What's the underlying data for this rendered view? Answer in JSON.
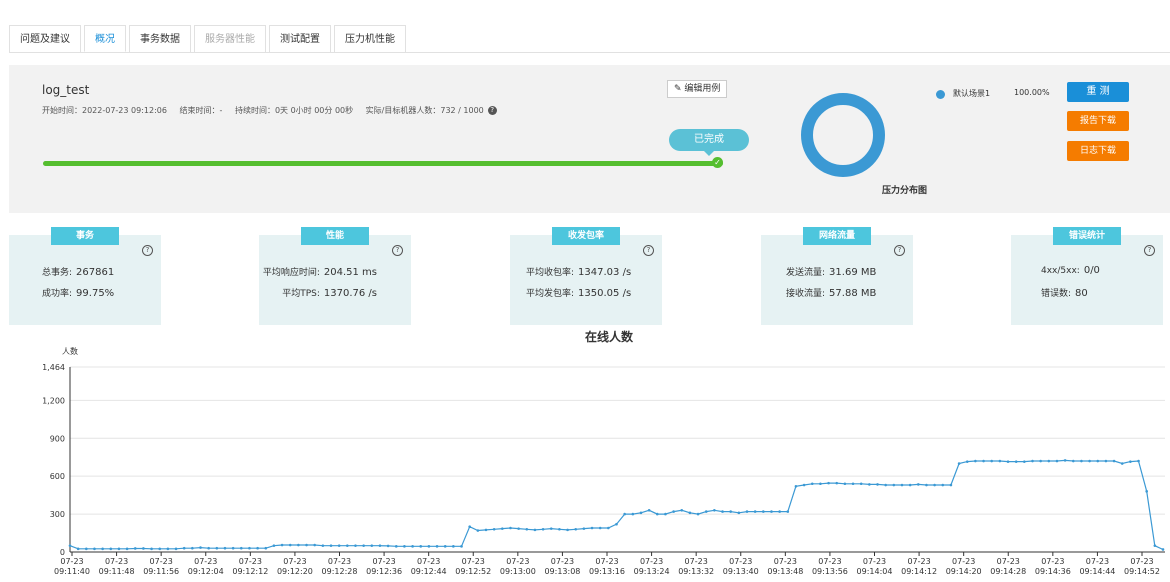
{
  "tabs": [
    {
      "label": "问题及建议",
      "state": "normal"
    },
    {
      "label": "概况",
      "state": "active"
    },
    {
      "label": "事务数据",
      "state": "normal"
    },
    {
      "label": "服务器性能",
      "state": "disabled"
    },
    {
      "label": "测试配置",
      "state": "normal"
    },
    {
      "label": "压力机性能",
      "state": "normal"
    }
  ],
  "summary": {
    "title": "log_test",
    "start": "开始时间：2022-07-23 09:12:06",
    "end": "结束时间：-",
    "duration": "持续时间：0天 0小时 00分 00秒",
    "machines": "实际/目标机器人数：732 / 1000",
    "help_icon": "question-circle-icon",
    "edit_label": "编辑用例",
    "edit_icon": "pencil-icon",
    "status": "已完成",
    "progress": 1.0,
    "donut_label": "压力分布图",
    "legend_name": "默认场景1",
    "legend_pct": "100.00%",
    "btn_retest": "重 测",
    "btn_report": "报告下载",
    "btn_log": "日志下载",
    "colors": {
      "accent": "#1a8fd8",
      "orange": "#f57c00",
      "green": "#55be2f",
      "teal": "#4dc6dd",
      "donut": "#3b99d4"
    }
  },
  "cards": [
    {
      "tab": "事务",
      "rows": [
        {
          "k": "总事务:",
          "v": "267861"
        },
        {
          "k": "成功率:",
          "v": "99.75%"
        }
      ]
    },
    {
      "tab": "性能",
      "rows": [
        {
          "k": "平均响应时间:",
          "v": "204.51 ms"
        },
        {
          "k": "平均TPS:",
          "v": "1370.76 /s"
        }
      ]
    },
    {
      "tab": "收发包率",
      "rows": [
        {
          "k": "平均收包率:",
          "v": "1347.03 /s"
        },
        {
          "k": "平均发包率:",
          "v": "1350.05 /s"
        }
      ]
    },
    {
      "tab": "网络流量",
      "rows": [
        {
          "k": "发送流量:",
          "v": "31.69 MB"
        },
        {
          "k": "接收流量:",
          "v": "57.88 MB"
        }
      ]
    },
    {
      "tab": "错误统计",
      "rows": [
        {
          "k": "4xx/5xx:",
          "v": "0/0"
        },
        {
          "k": "错误数:",
          "v": "80"
        }
      ]
    }
  ],
  "chart_data": {
    "type": "line",
    "title": "在线人数",
    "ylabel": "人数",
    "ylim": [
      0,
      1464
    ],
    "yticks": [
      0,
      300,
      600,
      900,
      1200,
      1464
    ],
    "ytick_labels": [
      "0",
      "300",
      "600",
      "900",
      "1,200",
      "1,464"
    ],
    "xtick_labels": [
      "07-23 09:11:40",
      "07-23 09:11:48",
      "07-23 09:11:56",
      "07-23 09:12:04",
      "07-23 09:12:12",
      "07-23 09:12:20",
      "07-23 09:12:28",
      "07-23 09:12:36",
      "07-23 09:12:44",
      "07-23 09:12:52",
      "07-23 09:13:00",
      "07-23 09:13:08",
      "07-23 09:13:16",
      "07-23 09:13:24",
      "07-23 09:13:32",
      "07-23 09:13:40",
      "07-23 09:13:48",
      "07-23 09:13:56",
      "07-23 09:14:04",
      "07-23 09:14:12",
      "07-23 09:14:20",
      "07-23 09:14:28",
      "07-23 09:14:36",
      "07-23 09:14:44",
      "07-23 09:14:52"
    ],
    "series": [
      {
        "color": "#3b99d4",
        "values": [
          50,
          25,
          25,
          25,
          25,
          25,
          25,
          25,
          28,
          28,
          25,
          25,
          25,
          25,
          30,
          30,
          35,
          30,
          30,
          30,
          30,
          30,
          30,
          30,
          30,
          50,
          55,
          55,
          55,
          55,
          55,
          50,
          50,
          50,
          50,
          50,
          50,
          50,
          50,
          48,
          45,
          45,
          45,
          45,
          45,
          45,
          45,
          45,
          45,
          200,
          170,
          175,
          180,
          185,
          190,
          185,
          180,
          175,
          180,
          185,
          180,
          175,
          180,
          185,
          190,
          190,
          190,
          220,
          300,
          300,
          310,
          330,
          300,
          300,
          320,
          330,
          310,
          300,
          320,
          330,
          320,
          320,
          310,
          320,
          320,
          320,
          320,
          320,
          320,
          520,
          530,
          540,
          540,
          545,
          545,
          540,
          540,
          540,
          535,
          535,
          530,
          530,
          530,
          530,
          535,
          530,
          530,
          530,
          530,
          700,
          715,
          720,
          720,
          720,
          720,
          715,
          715,
          715,
          720,
          720,
          720,
          720,
          725,
          720,
          720,
          720,
          720,
          720,
          720,
          700,
          715,
          720,
          480,
          50,
          20
        ]
      }
    ]
  }
}
